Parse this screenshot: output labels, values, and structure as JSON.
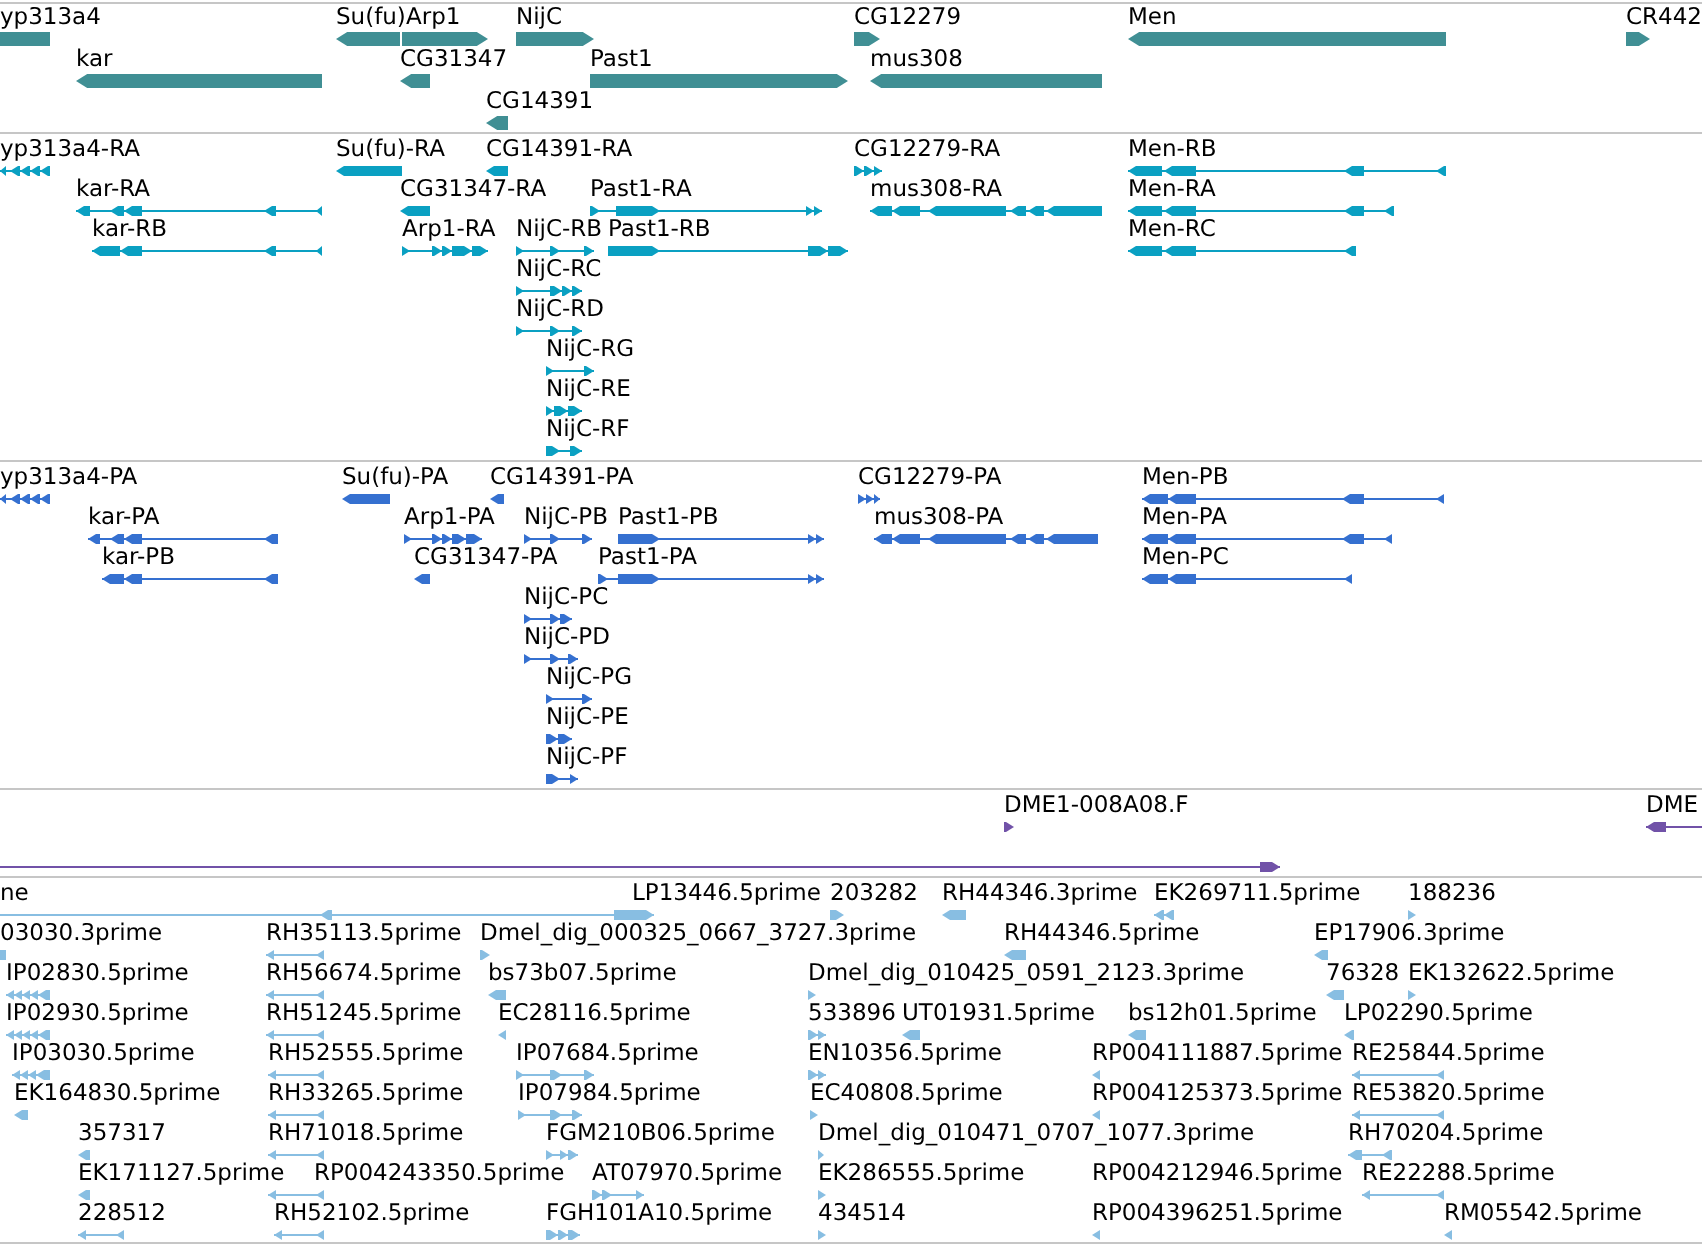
{
  "tracks": [
    {
      "kind": "gene",
      "features": [
        {
          "label": "yp313a4"
        },
        {
          "label": "Su(fu)"
        },
        {
          "label": "Arp1"
        },
        {
          "label": "NijC"
        },
        {
          "label": "CG12279"
        },
        {
          "label": "Men"
        },
        {
          "label": "CR442"
        },
        {
          "label": "kar"
        },
        {
          "label": "CG31347"
        },
        {
          "label": "Past1"
        },
        {
          "label": "mus308"
        },
        {
          "label": "CG14391"
        }
      ]
    },
    {
      "kind": "transcript",
      "features": [
        {
          "label": "yp313a4-RA"
        },
        {
          "label": "Su(fu)-RA"
        },
        {
          "label": "CG14391-RA"
        },
        {
          "label": "CG12279-RA"
        },
        {
          "label": "Men-RB"
        },
        {
          "label": "kar-RA"
        },
        {
          "label": "CG31347-RA"
        },
        {
          "label": "Past1-RA"
        },
        {
          "label": "mus308-RA"
        },
        {
          "label": "Men-RA"
        },
        {
          "label": "kar-RB"
        },
        {
          "label": "Arp1-RA"
        },
        {
          "label": "NijC-RB"
        },
        {
          "label": "Past1-RB"
        },
        {
          "label": "Men-RC"
        },
        {
          "label": "NijC-RC"
        },
        {
          "label": "NijC-RD"
        },
        {
          "label": "NijC-RG"
        },
        {
          "label": "NijC-RE"
        },
        {
          "label": "NijC-RF"
        }
      ]
    },
    {
      "kind": "protein",
      "features": [
        {
          "label": "yp313a4-PA"
        },
        {
          "label": "Su(fu)-PA"
        },
        {
          "label": "CG14391-PA"
        },
        {
          "label": "CG12279-PA"
        },
        {
          "label": "Men-PB"
        },
        {
          "label": "kar-PA"
        },
        {
          "label": "Arp1-PA"
        },
        {
          "label": "NijC-PB"
        },
        {
          "label": "Past1-PB"
        },
        {
          "label": "mus308-PA"
        },
        {
          "label": "Men-PA"
        },
        {
          "label": "kar-PB"
        },
        {
          "label": "CG31347-PA"
        },
        {
          "label": "Past1-PA"
        },
        {
          "label": "Men-PC"
        },
        {
          "label": "NijC-PC"
        },
        {
          "label": "NijC-PD"
        },
        {
          "label": "NijC-PG"
        },
        {
          "label": "NijC-PE"
        },
        {
          "label": "NijC-PF"
        }
      ]
    },
    {
      "kind": "clone",
      "features": [
        {
          "label": "DME1-008A08.F"
        },
        {
          "label": "DME"
        }
      ]
    },
    {
      "kind": "est",
      "features": [
        {
          "label": "ne"
        },
        {
          "label": "LP13446.5prime"
        },
        {
          "label": "203282"
        },
        {
          "label": "RH44346.3prime"
        },
        {
          "label": "EK269711.5prime"
        },
        {
          "label": "188236"
        },
        {
          "label": "03030.3prime"
        },
        {
          "label": "RH35113.5prime"
        },
        {
          "label": "Dmel_dig_000325_0667_3727.3prime"
        },
        {
          "label": "RH44346.5prime"
        },
        {
          "label": "EP17906.3prime"
        },
        {
          "label": "IP02830.5prime"
        },
        {
          "label": "RH56674.5prime"
        },
        {
          "label": "bs73b07.5prime"
        },
        {
          "label": "Dmel_dig_010425_0591_2123.3prime"
        },
        {
          "label": "76328"
        },
        {
          "label": "EK132622.5prime"
        },
        {
          "label": "IP02930.5prime"
        },
        {
          "label": "RH51245.5prime"
        },
        {
          "label": "EC28116.5prime"
        },
        {
          "label": "533896"
        },
        {
          "label": "UT01931.5prime"
        },
        {
          "label": "bs12h01.5prime"
        },
        {
          "label": "LP02290.5prime"
        },
        {
          "label": "IP03030.5prime"
        },
        {
          "label": "RH52555.5prime"
        },
        {
          "label": "IP07684.5prime"
        },
        {
          "label": "EN10356.5prime"
        },
        {
          "label": "RP004111887.5prime"
        },
        {
          "label": "RE25844.5prime"
        },
        {
          "label": "EK164830.5prime"
        },
        {
          "label": "RH33265.5prime"
        },
        {
          "label": "IP07984.5prime"
        },
        {
          "label": "EC40808.5prime"
        },
        {
          "label": "RP004125373.5prime"
        },
        {
          "label": "RE53820.5prime"
        },
        {
          "label": "357317"
        },
        {
          "label": "RH71018.5prime"
        },
        {
          "label": "FGM210B06.5prime"
        },
        {
          "label": "Dmel_dig_010471_0707_1077.3prime"
        },
        {
          "label": "RH70204.5prime"
        },
        {
          "label": "EK171127.5prime"
        },
        {
          "label": "RP004243350.5prime"
        },
        {
          "label": "AT07970.5prime"
        },
        {
          "label": "EK286555.5prime"
        },
        {
          "label": "RP004212946.5prime"
        },
        {
          "label": "RE22288.5prime"
        },
        {
          "label": "228512"
        },
        {
          "label": "RH52102.5prime"
        },
        {
          "label": "FGH101A10.5prime"
        },
        {
          "label": "434514"
        },
        {
          "label": "RP004396251.5prime"
        },
        {
          "label": "RM05542.5prime"
        }
      ]
    }
  ]
}
